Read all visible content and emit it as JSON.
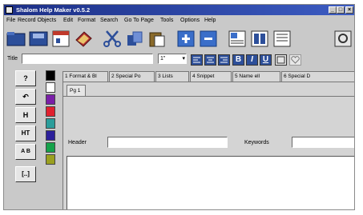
{
  "window": {
    "title": "Shalom Help Maker v0.5.2"
  },
  "menu": [
    "File",
    "Record Objects",
    "Edit",
    "Format",
    "Search",
    "Go To Page",
    "Tools",
    "Options",
    "Help"
  ],
  "toolbar": {
    "icons": [
      "open-folder-icon",
      "save-icon",
      "calendar-icon",
      "book-icon",
      "cut-icon",
      "copy-icon",
      "paste-icon",
      "add-page-icon",
      "remove-page-icon",
      "text-image-icon",
      "book-open-icon",
      "page-layout-icon",
      "settings-icon"
    ]
  },
  "format_bar": {
    "title_label": "Title",
    "title_value": "",
    "font_size": "1\"",
    "bold": "B",
    "italic": "I",
    "underline": "U"
  },
  "left_tools": [
    "?",
    "↶",
    "H",
    "HT",
    "A B",
    "[..]"
  ],
  "colors": [
    "#000000",
    "#ffffff",
    "#7a1fa8",
    "#e0212f",
    "#2a9d9b",
    "#2b1f9a",
    "#15a24a",
    "#9aa020"
  ],
  "tabs": [
    {
      "label": "1 Format & Bl"
    },
    {
      "label": "2 Special Po"
    },
    {
      "label": "3 Lists"
    },
    {
      "label": "4 Snippet"
    },
    {
      "label": "5 Name ell"
    },
    {
      "label": "6 Special D"
    }
  ],
  "page": {
    "tab_label": "Pg 1",
    "header_label": "Header",
    "header_value": "",
    "keywords_label": "Keywords",
    "keywords_value": ""
  }
}
